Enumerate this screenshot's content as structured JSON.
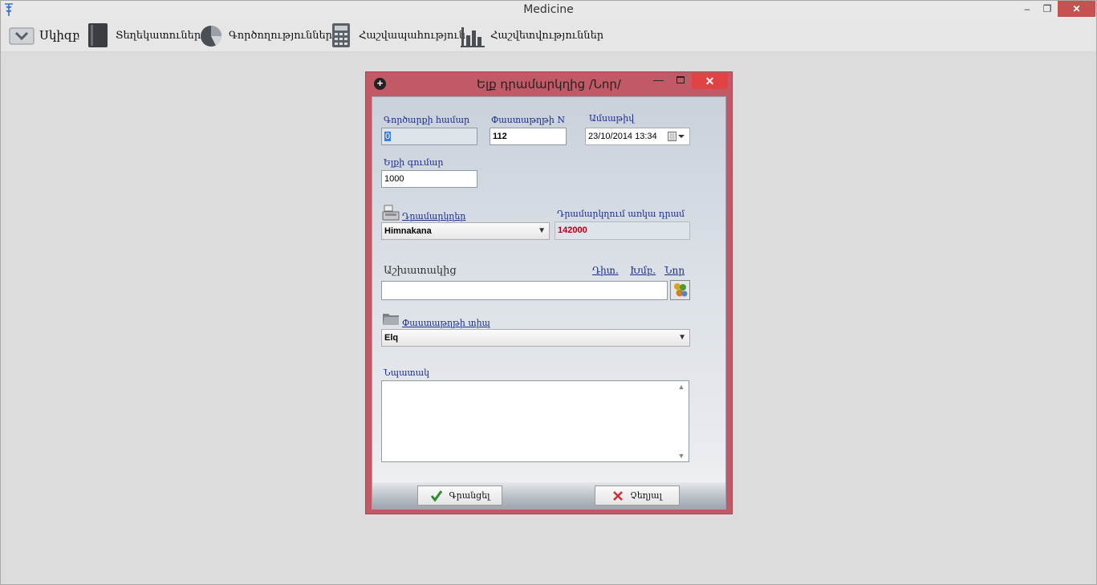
{
  "window": {
    "title": "Medicine",
    "controls": {
      "minimize": "–",
      "maximize": "❐",
      "close": "✕"
    }
  },
  "menu": [
    {
      "label": "Սկիզբ",
      "icon": "start-icon"
    },
    {
      "label": "Տեղեկատուներ",
      "icon": "book-icon"
    },
    {
      "label": "Գործողություններ",
      "icon": "pie-chart-icon"
    },
    {
      "label": "Հաշվապահություն",
      "icon": "calculator-icon"
    },
    {
      "label": "Հաշվետվություններ",
      "icon": "bar-chart-icon"
    }
  ],
  "dialog": {
    "title": "Ելք դրամարկղից /Նոր/",
    "fields": {
      "operation_number": {
        "label": "Գործարքի համար",
        "value": "0"
      },
      "document_number": {
        "label": "Փաստաթղթի N",
        "value": "112"
      },
      "date": {
        "label": "Ամսաթիվ",
        "value": "23/10/2014 13:34"
      },
      "amount": {
        "label": "Ելքի գումար",
        "value": "1000"
      },
      "cashboxes": {
        "label": "Դրամարկղեր",
        "value": "Himnakana"
      },
      "cash_in_box": {
        "label": "Դրամարկղում առկա դրամ",
        "value": "142000"
      },
      "employee": {
        "label": "Աշխատակից",
        "value": "",
        "links": [
          "Դիտ.",
          "Խմբ.",
          "Նոր"
        ]
      },
      "document_type": {
        "label": "Փաստաթղթի տիպ",
        "value": "Elq"
      },
      "note": {
        "label": "Նպատակ",
        "value": ""
      }
    },
    "buttons": {
      "ok": "Գրանցել",
      "cancel": "Չեղյալ"
    }
  },
  "colors": {
    "dialog_frame": "#c15a66",
    "close_button": "#e04343",
    "label_blue": "#1b2d8f",
    "cash_red": "#b0001a"
  }
}
